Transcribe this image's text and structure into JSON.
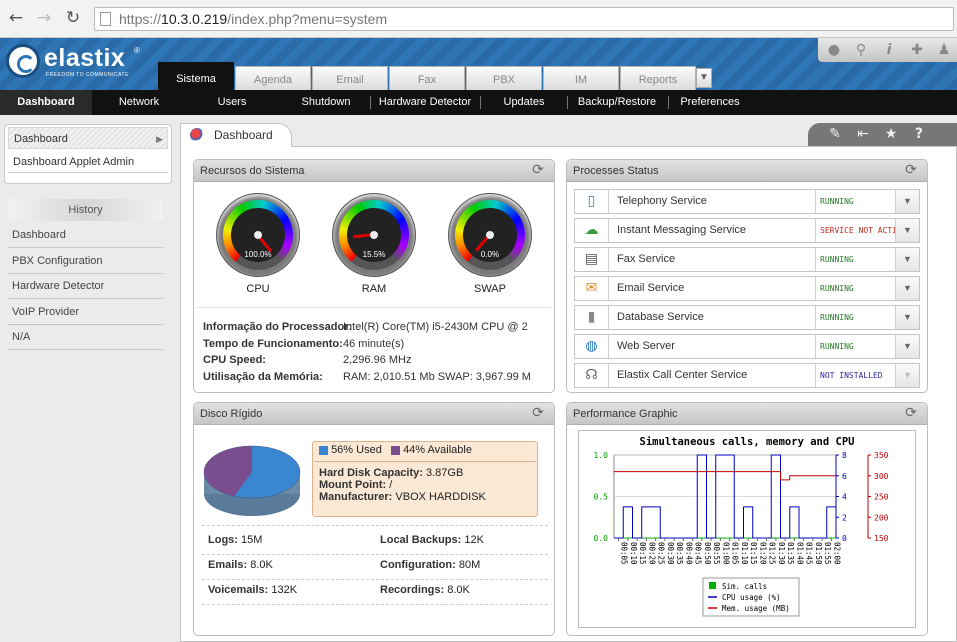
{
  "browser": {
    "url_prefix": "https://",
    "url_host": "10.3.0.219",
    "url_path": "/index.php?menu=system"
  },
  "logo": {
    "name": "elastix",
    "tagline": "FREEDOM TO COMMUNICATE",
    "reg": "®"
  },
  "top_tabs": [
    {
      "label": "Sistema",
      "active": true
    },
    {
      "label": "Agenda"
    },
    {
      "label": "Email"
    },
    {
      "label": "Fax"
    },
    {
      "label": "PBX"
    },
    {
      "label": "IM"
    },
    {
      "label": "Reports"
    }
  ],
  "top_icons": [
    "drop-icon",
    "search-icon",
    "info-icon",
    "puzzle-icon",
    "user-icon"
  ],
  "submenu": [
    {
      "label": "Dashboard",
      "active": true
    },
    {
      "label": "Network"
    },
    {
      "label": "Users"
    },
    {
      "label": "Shutdown"
    },
    {
      "label": "Hardware Detector"
    },
    {
      "label": "Updates"
    },
    {
      "label": "Backup/Restore"
    },
    {
      "label": "Preferences"
    }
  ],
  "sidebar": {
    "links": [
      "Dashboard",
      "Dashboard Applet Admin"
    ],
    "history_title": "History",
    "history": [
      "Dashboard",
      "PBX Configuration",
      "Hardware Detector",
      "VoIP Provider",
      "N/A"
    ]
  },
  "content_tab": "Dashboard",
  "action_icons": [
    "edit-icon",
    "sidebar-toggle-icon",
    "star-icon",
    "help-icon"
  ],
  "recursos": {
    "title": "Recursos do Sistema",
    "gauges": [
      {
        "label": "CPU",
        "value": "100.0%",
        "pct": 100
      },
      {
        "label": "RAM",
        "value": "15.5%",
        "pct": 15.5
      },
      {
        "label": "SWAP",
        "value": "0.0%",
        "pct": 0
      }
    ],
    "info": [
      {
        "label": "Informação do Processador:",
        "value": "Intel(R) Core(TM) i5-2430M CPU @ 2"
      },
      {
        "label": "Tempo de Funcionamento:",
        "value": "46 minute(s)"
      },
      {
        "label": "CPU Speed:",
        "value": "2,296.96 MHz"
      },
      {
        "label": "Utilisação da Memória:",
        "value": "RAM: 2,010.51 Mb SWAP: 3,967.99 M"
      }
    ]
  },
  "processes": {
    "title": "Processes Status",
    "items": [
      {
        "name": "Telephony Service",
        "status": "RUNNING",
        "color": "#2a7a2a",
        "icon": "phone-icon"
      },
      {
        "name": "Instant Messaging Service",
        "status": "SERVICE NOT ACTIVATED",
        "color": "#c0281e",
        "icon": "chat-icon"
      },
      {
        "name": "Fax Service",
        "status": "RUNNING",
        "color": "#2a7a2a",
        "icon": "fax-icon"
      },
      {
        "name": "Email Service",
        "status": "RUNNING",
        "color": "#2a7a2a",
        "icon": "email-icon"
      },
      {
        "name": "Database Service",
        "status": "RUNNING",
        "color": "#2a7a2a",
        "icon": "database-icon"
      },
      {
        "name": "Web Server",
        "status": "RUNNING",
        "color": "#2a7a2a",
        "icon": "globe-icon"
      },
      {
        "name": "Elastix Call Center Service",
        "status": "NOT INSTALLED",
        "color": "#2a2a9a",
        "icon": "headset-icon"
      }
    ]
  },
  "disco": {
    "title": "Disco Rígido",
    "used": "56% Used",
    "available": "44% Available",
    "used_color": "#3a86d0",
    "avail_color": "#7a4d8e",
    "used_pct": 56,
    "capacity_label": "Hard Disk Capacity:",
    "capacity": "3.87GB",
    "mount_label": "Mount Point:",
    "mount": "/",
    "manufacturer_label": "Manufacturer:",
    "manufacturer": "VBOX HARDDISK",
    "stats": [
      {
        "label": "Logs:",
        "value": "15M"
      },
      {
        "label": "Local Backups:",
        "value": "12K"
      },
      {
        "label": "Emails:",
        "value": "8.0K"
      },
      {
        "label": "Configuration:",
        "value": "80M"
      },
      {
        "label": "Voicemails:",
        "value": "132K"
      },
      {
        "label": "Recordings:",
        "value": "8.0K"
      }
    ]
  },
  "performance": {
    "title": "Performance Graphic"
  },
  "chart_data": {
    "type": "line",
    "title": "Simultaneous calls, memory and CPU",
    "x": [
      "00:05",
      "00:10",
      "00:15",
      "00:20",
      "00:25",
      "00:30",
      "00:35",
      "00:40",
      "00:45",
      "00:50",
      "00:55",
      "01:00",
      "01:05",
      "01:10",
      "01:15",
      "01:20",
      "01:25",
      "01:30",
      "01:35",
      "01:40",
      "01:45",
      "01:50",
      "01:55",
      "02:00"
    ],
    "series": [
      {
        "name": "Sim. calls",
        "axis": "left",
        "color": "#00b000",
        "values": [
          0,
          0,
          0,
          0,
          0,
          0,
          0,
          0,
          0,
          0,
          0,
          0,
          0,
          0,
          0,
          0,
          0,
          0,
          0,
          0,
          0,
          0,
          0,
          0
        ]
      },
      {
        "name": "CPU usage (%)",
        "axis": "right1",
        "color": "#0000c0",
        "values": [
          0,
          3,
          0,
          3,
          3,
          0,
          0,
          0,
          0,
          8,
          0,
          8,
          8,
          0,
          3,
          0,
          0,
          8,
          0,
          3,
          0,
          0,
          0,
          3
        ]
      },
      {
        "name": "Mem. usage (MB)",
        "axis": "right2",
        "color": "#c00000",
        "values": [
          310,
          310,
          310,
          310,
          310,
          310,
          310,
          310,
          310,
          310,
          310,
          310,
          310,
          310,
          310,
          310,
          310,
          310,
          290,
          300,
          300,
          300,
          300,
          300
        ]
      }
    ],
    "left_ticks": [
      "0.0",
      "0.5",
      "1.0"
    ],
    "ylim_left": [
      0,
      1
    ],
    "right1_ticks": [
      "0",
      "2",
      "4",
      "6",
      "8"
    ],
    "ylim_right1": [
      0,
      8
    ],
    "right2_ticks": [
      "150",
      "200",
      "250",
      "300",
      "350"
    ],
    "ylim_right2": [
      150,
      350
    ],
    "legend": [
      "Sim. calls",
      "CPU usage (%)",
      "Mem. usage (MB)"
    ],
    "legend_position": "bottom"
  }
}
